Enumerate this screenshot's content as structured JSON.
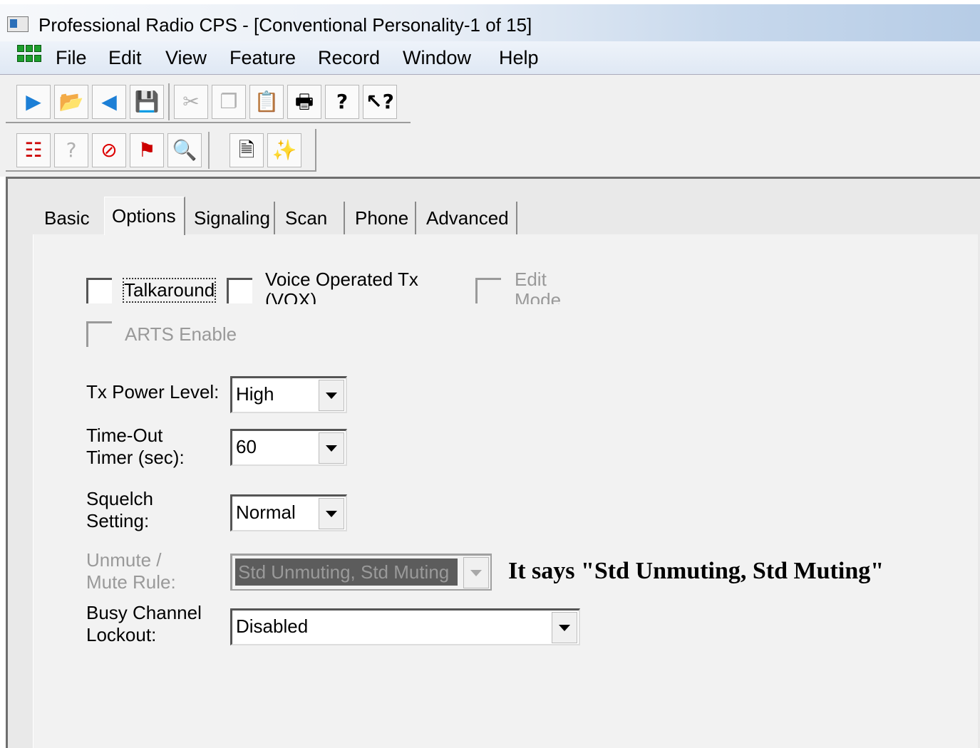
{
  "window": {
    "title": "Professional Radio CPS - [Conventional Personality-1 of 15]"
  },
  "menu": [
    "File",
    "Edit",
    "View",
    "Feature",
    "Record",
    "Window",
    "Help"
  ],
  "toolbar1": [
    "read-radio-icon",
    "open-file-icon",
    "write-radio-icon",
    "save-icon",
    "cut-icon",
    "copy-icon",
    "paste-icon",
    "print-icon",
    "help-icon",
    "context-help-icon"
  ],
  "toolbar2": [
    "tree-view-icon",
    "radio-info-icon",
    "disable-icon",
    "clone-icon",
    "search-icon",
    "report-icon",
    "wizard-icon"
  ],
  "tabs": [
    "Basic",
    "Options",
    "Signaling",
    "Scan",
    "Phone",
    "Advanced"
  ],
  "active_tab": "Options",
  "options": {
    "talkaround": "Talkaround",
    "vox_line1": "Voice Operated Tx",
    "vox_line2": "(VOX)",
    "edit_line1": "Edit",
    "edit_line2": "Mode",
    "arts": "ARTS Enable"
  },
  "fields": {
    "tx_power": {
      "label": "Tx Power Level:",
      "value": "High"
    },
    "timeout": {
      "label1": "Time-Out",
      "label2": "Timer (sec):",
      "value": "60"
    },
    "squelch": {
      "label1": "Squelch",
      "label2": "Setting:",
      "value": "Normal"
    },
    "unmute": {
      "label1": "Unmute /",
      "label2": "Mute Rule:",
      "value": "Std Unmuting, Std Muting"
    },
    "busy": {
      "label1": "Busy Channel",
      "label2": "Lockout:",
      "value": "Disabled"
    }
  },
  "annotation": "It says \"Std Unmuting, Std Muting\""
}
